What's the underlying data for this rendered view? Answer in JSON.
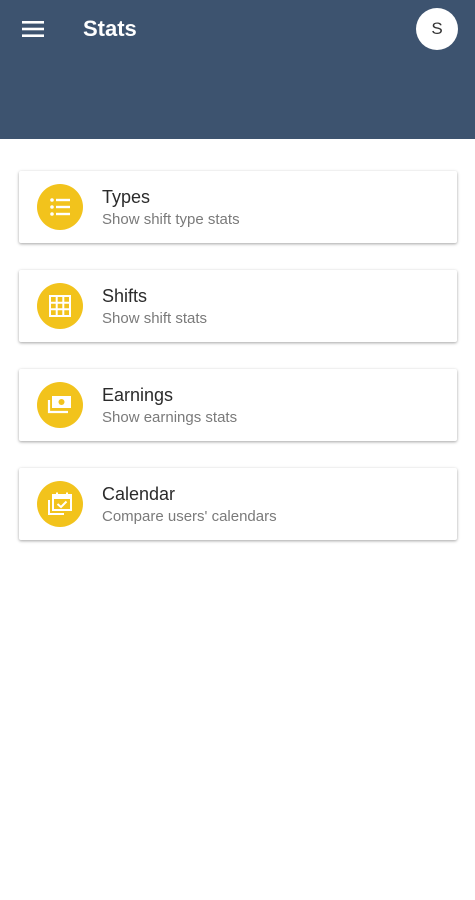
{
  "appbar": {
    "title": "Stats",
    "avatar_initial": "S",
    "color": "#3d536f"
  },
  "accent_color": "#f2c31c",
  "cards": [
    {
      "title": "Types",
      "subtitle": "Show shift type stats",
      "icon": "list-icon"
    },
    {
      "title": "Shifts",
      "subtitle": "Show shift stats",
      "icon": "grid-icon"
    },
    {
      "title": "Earnings",
      "subtitle": "Show earnings stats",
      "icon": "money-icon"
    },
    {
      "title": "Calendar",
      "subtitle": "Compare users' calendars",
      "icon": "calendar-check-icon"
    }
  ]
}
